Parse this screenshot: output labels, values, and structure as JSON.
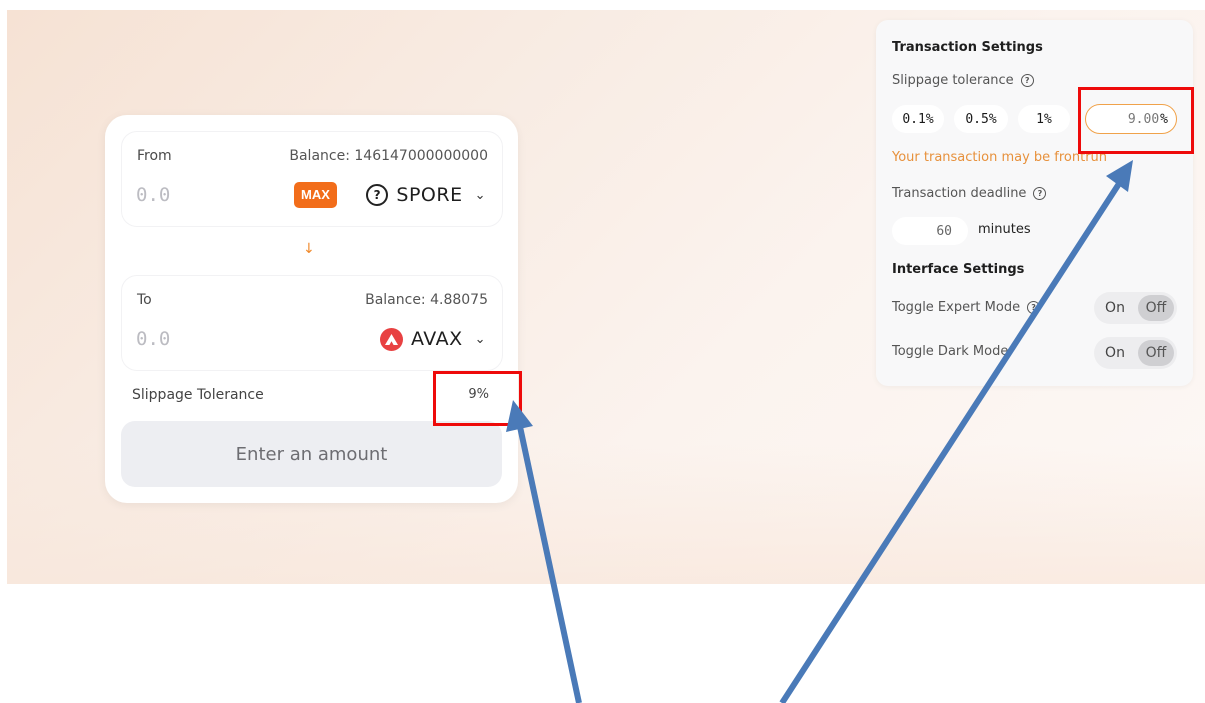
{
  "swap": {
    "from": {
      "label": "From",
      "balance": "Balance: 146147000000000",
      "amount_placeholder": "0.0",
      "max_label": "MAX",
      "token": "SPORE",
      "token_icon": "question-circle-icon"
    },
    "to": {
      "label": "To",
      "balance": "Balance: 4.88075",
      "amount_placeholder": "0.0",
      "token": "AVAX",
      "token_icon": "avax-logo-icon"
    },
    "slippage_label": "Slippage Tolerance",
    "slippage_value": "9%",
    "submit_label": "Enter an amount"
  },
  "settings": {
    "transaction_heading": "Transaction Settings",
    "slippage_label": "Slippage tolerance",
    "presets": [
      "0.1%",
      "0.5%",
      "1%"
    ],
    "custom_slippage_value": "9.00",
    "custom_slippage_suffix": "%",
    "warning": "Your transaction may be frontrun",
    "deadline_label": "Transaction deadline",
    "deadline_value": "60",
    "deadline_unit": "minutes",
    "interface_heading": "Interface Settings",
    "expert_mode_label": "Toggle Expert Mode",
    "dark_mode_label": "Toggle Dark Mode",
    "toggle_on": "On",
    "toggle_off": "Off"
  },
  "colors": {
    "accent": "#f26d1a",
    "warning": "#e7913c",
    "highlight": "#ee0a0a",
    "arrow": "#4a7ab8",
    "avax": "#e84142"
  }
}
